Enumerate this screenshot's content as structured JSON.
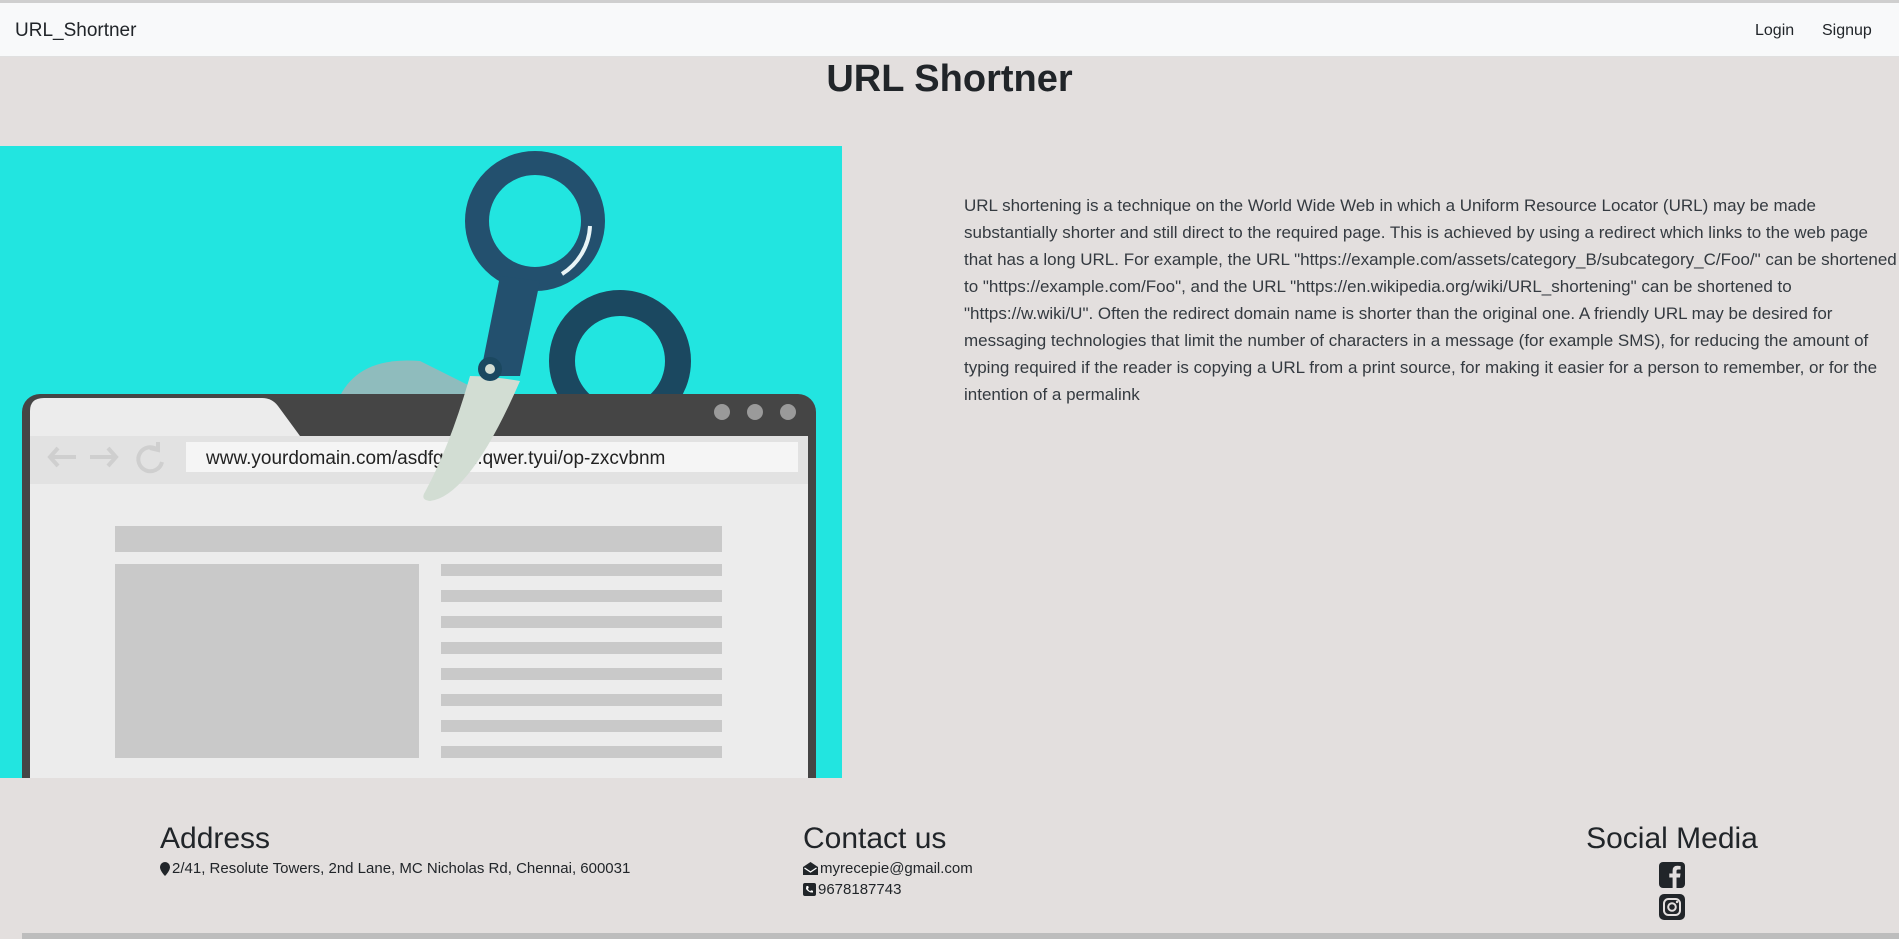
{
  "navbar": {
    "brand": "URL_Shortner",
    "links": [
      "Login",
      "Signup"
    ]
  },
  "page": {
    "title": "URL Shortner",
    "description": "URL shortening is a technique on the World Wide Web in which a Uniform Resource Locator (URL) may be made substantially shorter and still direct to the required page. This is achieved by using a redirect which links to the web page that has a long URL. For example, the URL \"https://example.com/assets/category_B/subcategory_C/Foo/\" can be shortened to \"https://example.com/Foo\", and the URL \"https://en.wikipedia.org/wiki/URL_shortening\" can be shortened to \"https://w.wiki/U\". Often the redirect domain name is shorter than the original one. A friendly URL may be desired for messaging technologies that limit the number of characters in a message (for example SMS), for reducing the amount of typing required if the reader is copying a URL from a print source, for making it easier for a person to remember, or for the intention of a permalink"
  },
  "hero_image": {
    "url_text": "www.yourdomain.com/asdfgh/jkl.qwer.tyui/op-zxcvbnm",
    "background": "#22e5e0",
    "icons": [
      "back-arrow-icon",
      "forward-arrow-icon",
      "reload-icon",
      "scissors-icon"
    ]
  },
  "footer": {
    "address": {
      "heading": "Address",
      "text": "2/41, Resolute Towers, 2nd Lane, MC Nicholas Rd, Chennai, 600031",
      "icon": "map-marker-icon"
    },
    "contact": {
      "heading": "Contact us",
      "email": "myrecepie@gmail.com",
      "phone": "9678187743",
      "icons": [
        "envelope-icon",
        "phone-icon"
      ]
    },
    "social": {
      "heading": "Social Media",
      "icons": [
        "facebook-icon",
        "instagram-icon"
      ]
    }
  }
}
